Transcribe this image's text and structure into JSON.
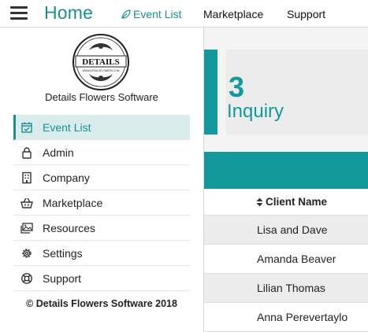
{
  "header": {
    "title": "Home",
    "nav": [
      {
        "label": "Event List",
        "icon": "leaf-icon",
        "active": true
      },
      {
        "label": "Marketplace"
      },
      {
        "label": "Support"
      }
    ]
  },
  "sidebar": {
    "logo_text": "DETAILS",
    "logo_url_text": "WWW.DETAILSFLOWERS.COM",
    "company_name": "Details Flowers Software",
    "items": [
      {
        "label": "Event List",
        "icon": "calendar-check-icon",
        "active": true
      },
      {
        "label": "Admin",
        "icon": "lock-icon"
      },
      {
        "label": "Company",
        "icon": "building-icon"
      },
      {
        "label": "Marketplace",
        "icon": "basket-icon"
      },
      {
        "label": "Resources",
        "icon": "images-icon"
      },
      {
        "label": "Settings",
        "icon": "gear-icon"
      },
      {
        "label": "Support",
        "icon": "lifebuoy-icon"
      }
    ],
    "copyright": "© Details Flowers Software 2018"
  },
  "main": {
    "inquiry_count": "3",
    "inquiry_label": "Inquiry",
    "table": {
      "column_header": "Client Name",
      "rows": [
        "Lisa and Dave",
        "Amanda Beaver",
        "Lilian Thomas",
        "Anna Perevertaylo"
      ]
    }
  },
  "colors": {
    "accent": "#13989b",
    "active_bg": "#d8ecec"
  }
}
